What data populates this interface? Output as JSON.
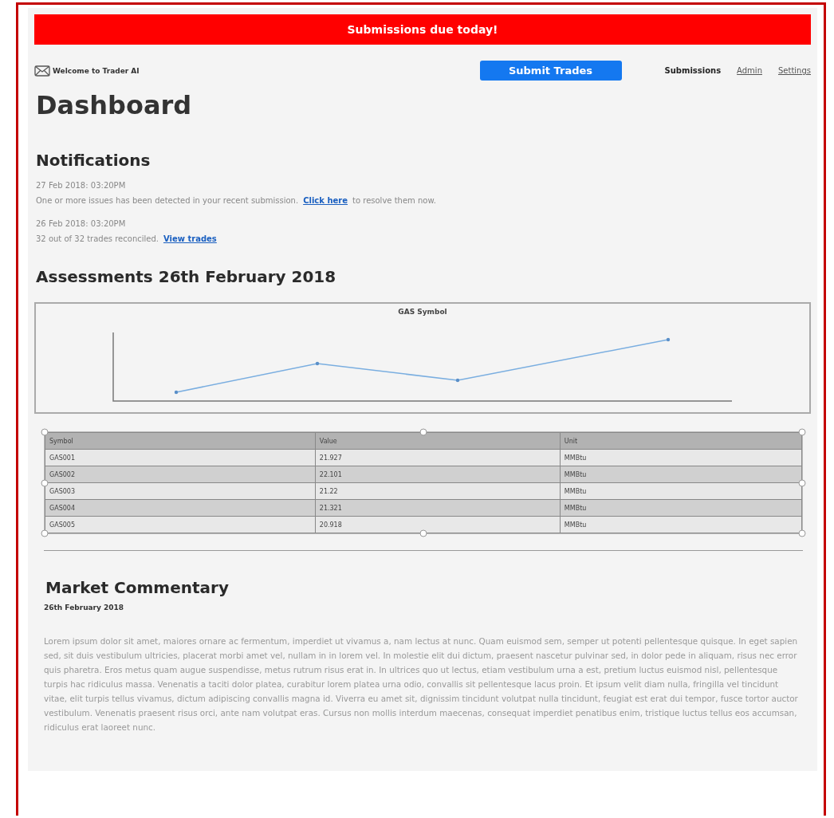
{
  "banner": {
    "text": "Submissions due today!"
  },
  "header": {
    "brand": "Welcome to Trader AI",
    "submit_button": "Submit Trades",
    "nav": [
      {
        "label": "Submissions",
        "selected": true
      },
      {
        "label": "Admin",
        "selected": false
      },
      {
        "label": "Settings",
        "selected": false
      }
    ]
  },
  "page_title": "Dashboard",
  "notifications": {
    "title": "Notifications",
    "items": [
      {
        "time": "27 Feb 2018: 03:20PM",
        "text_before": "One or more issues has been detected in your recent submission.",
        "link": "Click here",
        "text_after": "to resolve them now."
      },
      {
        "time": "26 Feb 2018: 03:20PM",
        "text_before": "32 out of 32 trades reconciled.",
        "link": "View trades"
      }
    ]
  },
  "assessments": {
    "title": "Assessments 26th February 2018",
    "chart_title": "GAS Symbol",
    "table": {
      "columns": [
        "Symbol",
        "Value",
        "Unit"
      ],
      "rows": [
        [
          "GAS001",
          "21.927",
          "MMBtu"
        ],
        [
          "GAS002",
          "22.101",
          "MMBtu"
        ],
        [
          "GAS003",
          "21.22",
          "MMBtu"
        ],
        [
          "GAS004",
          "21.321",
          "MMBtu"
        ],
        [
          "GAS005",
          "20.918",
          "MMBtu"
        ]
      ]
    }
  },
  "commentary": {
    "title": "Market Commentary",
    "date": "26th February 2018",
    "body": "Lorem ipsum dolor sit amet, maiores ornare ac fermentum, imperdiet ut vivamus a, nam lectus at nunc. Quam euismod sem, semper ut potenti pellentesque quisque. In eget sapien sed, sit duis vestibulum ultricies, placerat morbi amet vel, nullam in in lorem vel. In molestie elit dui dictum, praesent nascetur pulvinar sed, in dolor pede in aliquam, risus nec error quis pharetra. Eros metus quam augue suspendisse, metus rutrum risus erat in.  In ultrices quo ut lectus, etiam vestibulum urna a est, pretium luctus euismod nisl, pellentesque turpis hac ridiculus massa. Venenatis a taciti dolor platea, curabitur lorem platea urna odio, convallis sit pellentesque lacus proin. Et ipsum velit diam nulla, fringilla vel tincidunt vitae, elit turpis tellus vivamus, dictum adipiscing convallis magna id. Viverra eu amet sit, dignissim tincidunt volutpat nulla tincidunt, feugiat est erat dui tempor, fusce tortor auctor vestibulum. Venenatis praesent risus orci, ante nam volutpat eras. Cursus non mollis interdum maecenas, consequat imperdiet penatibus enim, tristique luctus tellus eos accumsan, ridiculus erat laoreet nunc."
  }
}
